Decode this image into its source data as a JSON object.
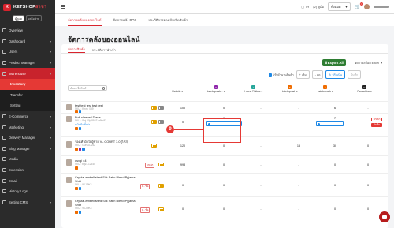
{
  "brand": {
    "name_main": "KETSHOP",
    "name_accent": "สาขา",
    "badge": "K",
    "role_a": "ผู้ดูแล",
    "role_b": "เครือข่าย"
  },
  "sidebar": {
    "items": [
      {
        "label": "Overview",
        "kind": "normal",
        "chev": false
      },
      {
        "label": "Dashboard",
        "kind": "normal",
        "chev": true
      },
      {
        "label": "Users",
        "kind": "normal",
        "chev": true
      },
      {
        "label": "Product Manager",
        "kind": "normal",
        "chev": true
      },
      {
        "label": "Warehouse",
        "kind": "red",
        "chev": true
      },
      {
        "label": "Inventory",
        "kind": "sub-active",
        "chev": false
      },
      {
        "label": "Transfer",
        "kind": "sub",
        "chev": false
      },
      {
        "label": "Setting",
        "kind": "sub",
        "chev": false
      },
      {
        "label": "E-Commerce",
        "kind": "normal",
        "chev": true
      },
      {
        "label": "Marketing",
        "kind": "normal",
        "chev": true
      },
      {
        "label": "Delivery Manager",
        "kind": "normal",
        "chev": true
      },
      {
        "label": "Blog Manager",
        "kind": "normal",
        "chev": true
      },
      {
        "label": "Media",
        "kind": "normal",
        "chev": false
      },
      {
        "label": "Extension",
        "kind": "normal",
        "chev": false
      },
      {
        "label": "Email",
        "kind": "normal",
        "chev": false
      },
      {
        "label": "History Logs",
        "kind": "normal",
        "chev": false
      },
      {
        "label": "Setting CMS",
        "kind": "normal",
        "chev": true
      }
    ]
  },
  "topbar": {
    "lang": "TH",
    "shop_label": "(2) คู่มือ",
    "branch_select": "ทั้งหมด",
    "cart_badge": "0"
  },
  "tabs_main": [
    {
      "label": "จัดการคลังของออนไลน์",
      "active": true
    },
    {
      "label": "จัดการคลัง POS",
      "active": false
    },
    {
      "label": "ประวัติการยอดนับเปิดสินค้า",
      "active": false
    }
  ],
  "page_title": "จัดการคลังของออนไลน์",
  "tabs_sub": [
    {
      "label": "จัดการสินค้า",
      "active": true
    },
    {
      "label": "ประวัติการนำเข้า",
      "active": false
    }
  ],
  "export_label": "Export All",
  "export_select": "จัดการสต็อก Excel",
  "controls": {
    "checkbox_label": "ปรับจำนวนสินค้า",
    "add": "+ เพิ่ม",
    "sub": "- ลด",
    "reset": "↻ ปรับเป็น",
    "disabled": "บันทึก"
  },
  "search_placeholder": "ค้นหาชื่อสินค้า",
  "columns": {
    "website": "Website",
    "c1": "ketshopweb",
    "c2": "Lomat Clothes",
    "c3": "ketshopweb",
    "c4": "ketshopweb",
    "c5": "Canfashion"
  },
  "rows": [
    {
      "name": "test test test test test",
      "sku": "SKU : Kinm_059",
      "website": "100",
      "c1": "0",
      "c2": "-",
      "c3": "-",
      "c4": "6",
      "c5": "-"
    },
    {
      "name": "Puff-sleeved Dress",
      "sku": "SKU : 8wj-20ja89JS1a9tb83",
      "link": "ดูเงินค้า/ตั้งค่า",
      "website": "0",
      "c1": "0",
      "c4": "7",
      "btn_a": "ยกเลิก",
      "btn_b": "บันทึก"
    },
    {
      "name": "รองเท้าผ้าใบผู้ชาย VL COURT 3.0 [ไซส]",
      "sku": "SKU : G0N0JJ252",
      "website": "120",
      "c1": "0",
      "c2": "-",
      "c3": "15",
      "c4": "30",
      "c5": "0"
    },
    {
      "name": "dsvqi 44",
      "sku": "SKU : bqvJ-12345",
      "website": "998",
      "c1": "0",
      "c2": "-",
      "c3": "-",
      "c4": "0",
      "c5": "0"
    },
    {
      "name": "Crystal-embellished Silk Satin Blend Pyjama Shirt",
      "sku": "SKU : 9KJ-9K3",
      "website": "0",
      "c1": "0",
      "c2": "-",
      "c3": "-",
      "c4": "0",
      "c5": "0"
    },
    {
      "name": "Crystal-embellished Silk Satin Blend Pyjama Shirt",
      "sku": "SKU : 9KJ-9K3",
      "website": "0",
      "c1": "0",
      "c2": "-",
      "c3": "-",
      "c4": "0",
      "c5": "0"
    }
  ],
  "tag_ship": "1 - ขั้น",
  "marker": "9"
}
